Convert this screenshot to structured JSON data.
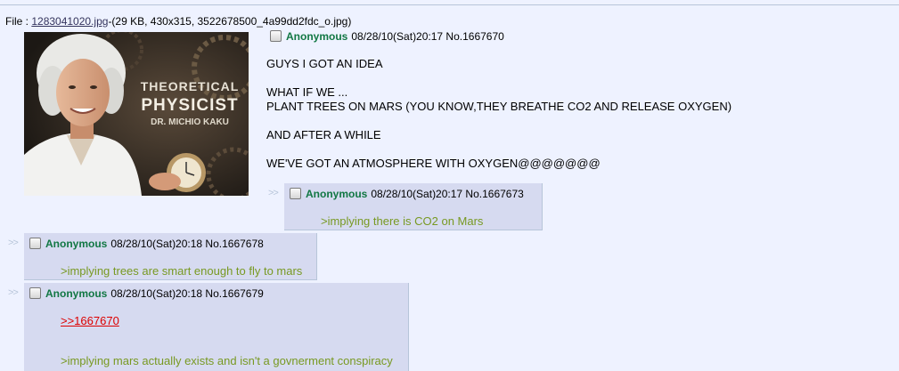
{
  "file": {
    "prefix": "File : ",
    "filename": "1283041020.jpg",
    "details": "-(29 KB, 430x315, 3522678500_4a99dd2fdc_o.jpg)"
  },
  "thumbnail": {
    "lines": [
      "THEORETICAL",
      "PHYSICIST",
      "DR. MICHIO KAKU"
    ]
  },
  "op": {
    "name": "Anonymous",
    "meta": "08/28/10(Sat)20:17 No.1667670",
    "lines": [
      "GUYS I GOT AN IDEA",
      "WHAT IF WE ...",
      "PLANT TREES ON MARS (YOU KNOW,THEY BREATHE CO2 AND RELEASE OXYGEN)",
      "AND AFTER A WHILE",
      "WE'VE GOT AN ATMOSPHERE WITH OXYGEN@@@@@@@"
    ]
  },
  "replies": [
    {
      "arrows": ">>",
      "name": "Anonymous",
      "meta": "08/28/10(Sat)20:17 No.1667673",
      "text": ">implying there is CO2 on Mars"
    },
    {
      "arrows": ">>",
      "name": "Anonymous",
      "meta": "08/28/10(Sat)20:18 No.1667678",
      "text": ">implying trees are smart enough to fly to mars"
    },
    {
      "arrows": ">>",
      "name": "Anonymous",
      "meta": "08/28/10(Sat)20:18 No.1667679",
      "quotelink": ">>1667670",
      "text": ">implying mars actually exists and isn't a govnerment conspiracy"
    }
  ],
  "colors": {
    "background": "#eef2ff",
    "reply_background": "#d6daf0",
    "name": "#117743",
    "greentext": "#789922",
    "quotelink": "#dd0000"
  }
}
